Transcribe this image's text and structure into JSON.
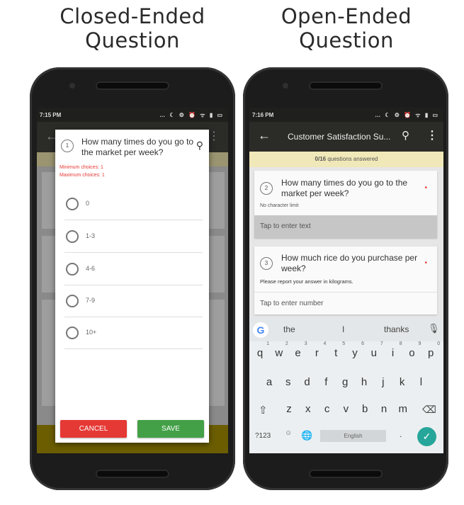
{
  "headings": {
    "left": [
      "Closed-Ended",
      "Question"
    ],
    "right": [
      "Open-Ended",
      "Question"
    ]
  },
  "left_phone": {
    "time": "7:15 PM",
    "status_icons": "… ☾ ⚙ ⏰ ᯤ ▮ ▭",
    "dialog": {
      "number": "1",
      "question": "How many times do you go to the market per week?",
      "min_choices": "Minimum choices: 1",
      "max_choices": "Maximum choices: 1",
      "options": [
        "0",
        "1-3",
        "4-6",
        "7-9",
        "10+"
      ],
      "cancel_label": "CANCEL",
      "save_label": "SAVE"
    },
    "colors": {
      "cancel": "#e53935",
      "save": "#43a047"
    }
  },
  "right_phone": {
    "time": "7:16 PM",
    "status_icons": "… ☾ ⚙ ⏰ ᯤ ▮ ▭",
    "toolbar_title": "Customer Satisfaction Su...",
    "progress": {
      "count": "0/16",
      "label": " questions answered"
    },
    "questions": [
      {
        "number": "2",
        "text": "How many times do you go to the market per week?",
        "hint": "No character limit",
        "placeholder": "Tap to enter text"
      },
      {
        "number": "3",
        "text": "How much rice do you purchase per week?",
        "hint": "Please report your answer in kilograms.",
        "placeholder": "Tap to enter number"
      }
    ],
    "keyboard": {
      "suggestions": [
        "the",
        "I",
        "thanks"
      ],
      "row1": [
        "q",
        "w",
        "e",
        "r",
        "t",
        "y",
        "u",
        "i",
        "o",
        "p"
      ],
      "row1_nums": [
        "1",
        "2",
        "3",
        "4",
        "5",
        "6",
        "7",
        "8",
        "9",
        "0"
      ],
      "row2": [
        "a",
        "s",
        "d",
        "f",
        "g",
        "h",
        "j",
        "k",
        "l"
      ],
      "row3": [
        "z",
        "x",
        "c",
        "v",
        "b",
        "n",
        "m"
      ],
      "symbols_label": "?123",
      "space_label": "English",
      "period": "."
    },
    "colors": {
      "toolbar": "#2b2b28",
      "progress_bar": "#f0e8b8",
      "enter_key": "#26a69a"
    }
  }
}
